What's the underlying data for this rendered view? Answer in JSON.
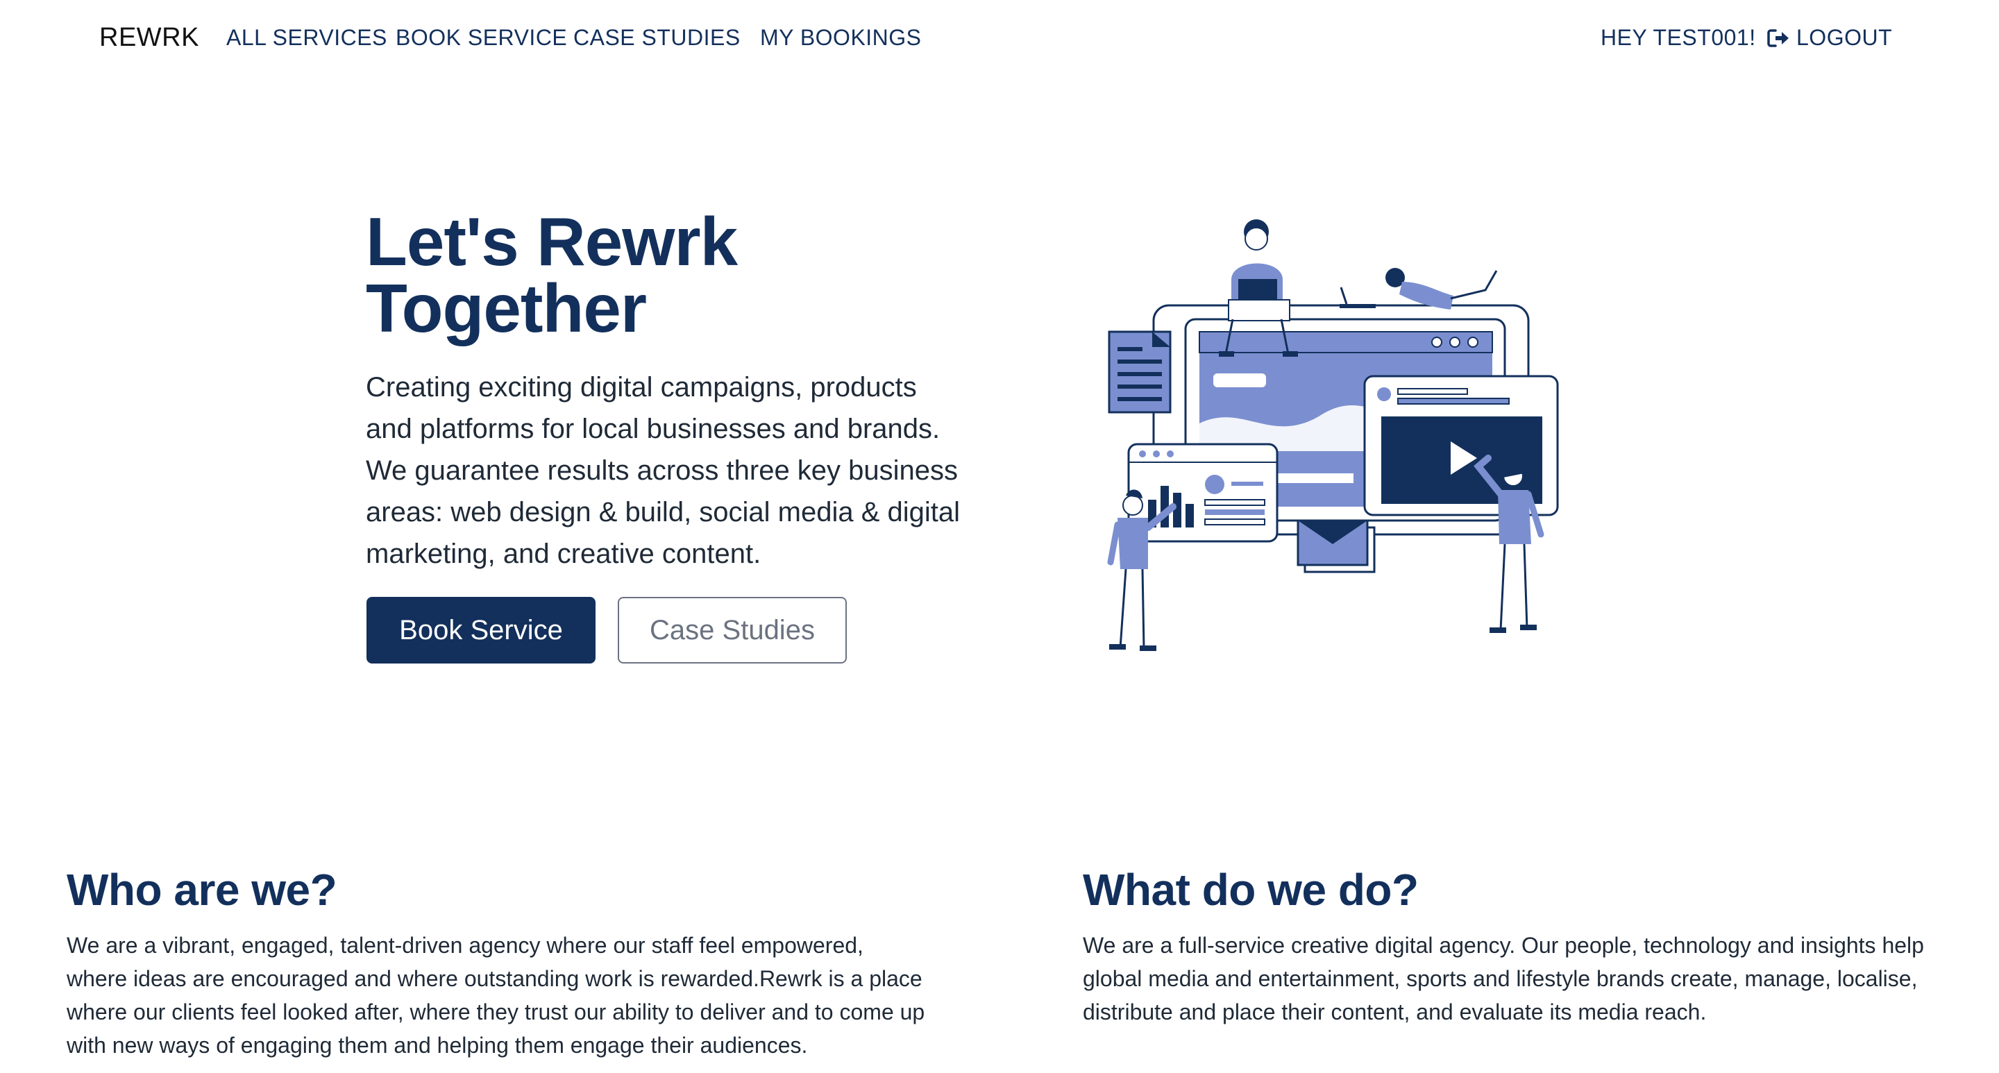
{
  "nav": {
    "brand": "REWRK",
    "links": [
      "ALL SERVICES",
      "BOOK SERVICE",
      "CASE STUDIES",
      "MY BOOKINGS"
    ],
    "greeting": "HEY TEST001!",
    "logout": "LOGOUT"
  },
  "hero": {
    "title_line1": "Let's Rewrk",
    "title_line2": "Together",
    "description": "Creating exciting digital campaigns, products and platforms for local businesses and brands. We guarantee results across three key business areas: web design & build, social media & digital marketing, and creative content.",
    "primary_button": "Book Service",
    "secondary_button": "Case Studies"
  },
  "about": {
    "title": "Who are we?",
    "body": "We are a vibrant, engaged, talent-driven agency where our staff feel empowered, where ideas are encouraged and where outstanding work is rewarded.Rewrk is a place where our clients feel looked after, where they trust our ability to deliver and to come up with new ways of engaging them and helping them engage their audiences."
  },
  "services": {
    "title": "What do we do?",
    "body": "We are a full-service creative digital agency. Our people, technology and insights help global media and entertainment, sports and lifestyle brands create, manage, localise, distribute and place their content, and evaluate its media reach."
  },
  "colors": {
    "primary": "#13305c",
    "accent": "#7b8fd0",
    "text": "#1f2a37",
    "muted": "#6b7280"
  },
  "icons": {
    "logout": "sign-out-icon"
  }
}
